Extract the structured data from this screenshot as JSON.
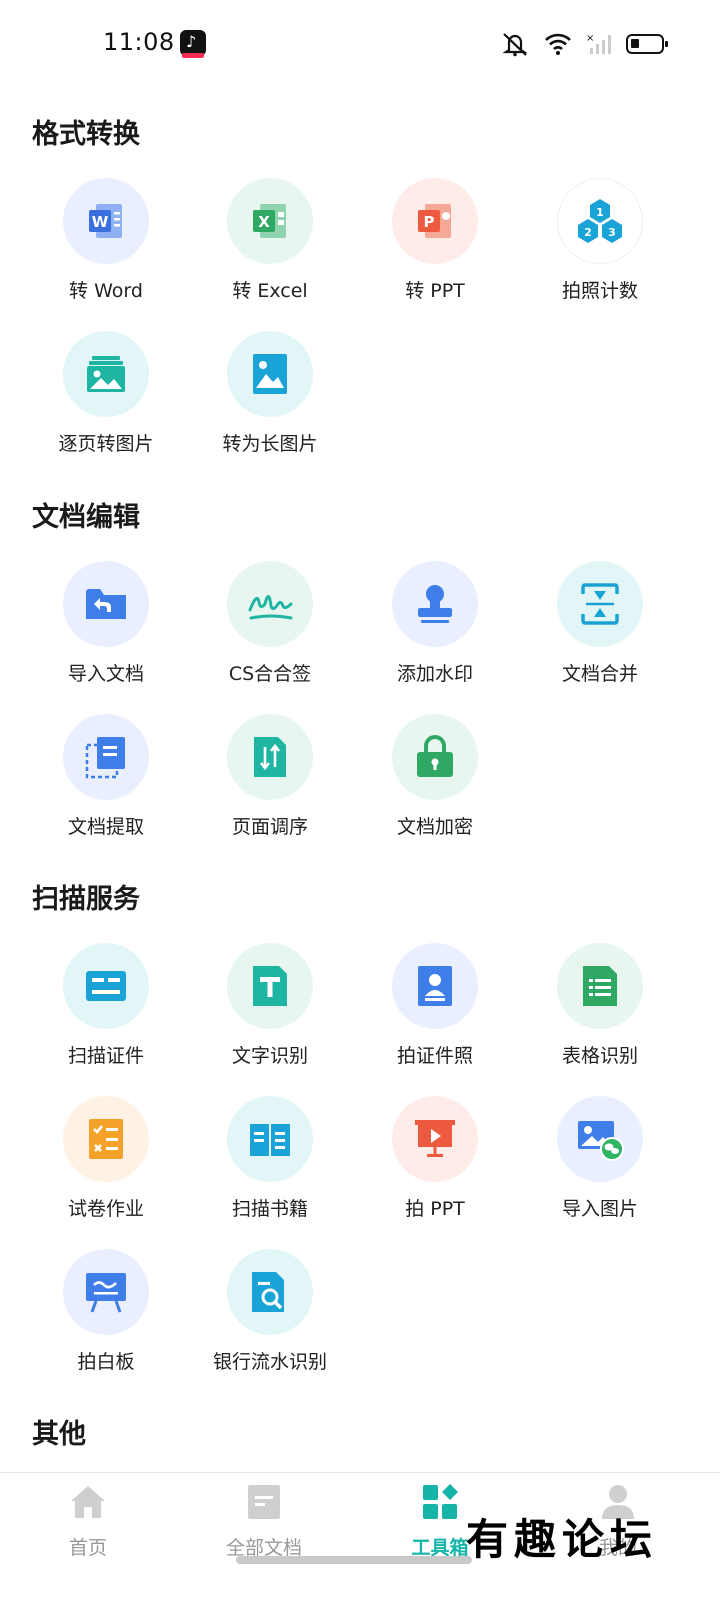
{
  "status": {
    "time": "11:08"
  },
  "sections": [
    {
      "title": "格式转换",
      "items": [
        {
          "label": "转 Word",
          "icon": "word-icon"
        },
        {
          "label": "转 Excel",
          "icon": "excel-icon"
        },
        {
          "label": "转 PPT",
          "icon": "ppt-icon"
        },
        {
          "label": "拍照计数",
          "icon": "count-hexagon-icon"
        },
        {
          "label": "逐页转图片",
          "icon": "image-stack-icon"
        },
        {
          "label": "转为长图片",
          "icon": "long-image-icon"
        }
      ]
    },
    {
      "title": "文档编辑",
      "items": [
        {
          "label": "导入文档",
          "icon": "import-folder-icon"
        },
        {
          "label": "CS合合签",
          "icon": "signature-icon"
        },
        {
          "label": "添加水印",
          "icon": "stamp-icon"
        },
        {
          "label": "文档合并",
          "icon": "merge-icon"
        },
        {
          "label": "文档提取",
          "icon": "extract-icon"
        },
        {
          "label": "页面调序",
          "icon": "reorder-icon"
        },
        {
          "label": "文档加密",
          "icon": "lock-icon"
        }
      ]
    },
    {
      "title": "扫描服务",
      "items": [
        {
          "label": "扫描证件",
          "icon": "id-card-icon"
        },
        {
          "label": "文字识别",
          "icon": "text-recognition-icon"
        },
        {
          "label": "拍证件照",
          "icon": "id-photo-icon"
        },
        {
          "label": "表格识别",
          "icon": "table-recognition-icon"
        },
        {
          "label": "试卷作业",
          "icon": "exam-icon"
        },
        {
          "label": "扫描书籍",
          "icon": "book-icon"
        },
        {
          "label": "拍 PPT",
          "icon": "presentation-icon"
        },
        {
          "label": "导入图片",
          "icon": "import-image-icon"
        },
        {
          "label": "拍白板",
          "icon": "whiteboard-icon"
        },
        {
          "label": "银行流水识别",
          "icon": "bank-statement-icon"
        }
      ]
    },
    {
      "title": "其他",
      "items": []
    }
  ],
  "nav": [
    {
      "label": "首页",
      "icon": "home-icon",
      "active": false
    },
    {
      "label": "全部文档",
      "icon": "documents-icon",
      "active": false
    },
    {
      "label": "工具箱",
      "icon": "toolbox-icon",
      "active": true
    },
    {
      "label": "我的",
      "icon": "profile-icon",
      "active": false
    }
  ],
  "watermark": "有趣论坛",
  "colors": {
    "accent": "#16b3a8",
    "word": "#3b6fe0",
    "excel": "#2fa864",
    "ppt": "#ee5a3f",
    "teal": "#1fb5a3",
    "blue": "#3f7de8"
  }
}
